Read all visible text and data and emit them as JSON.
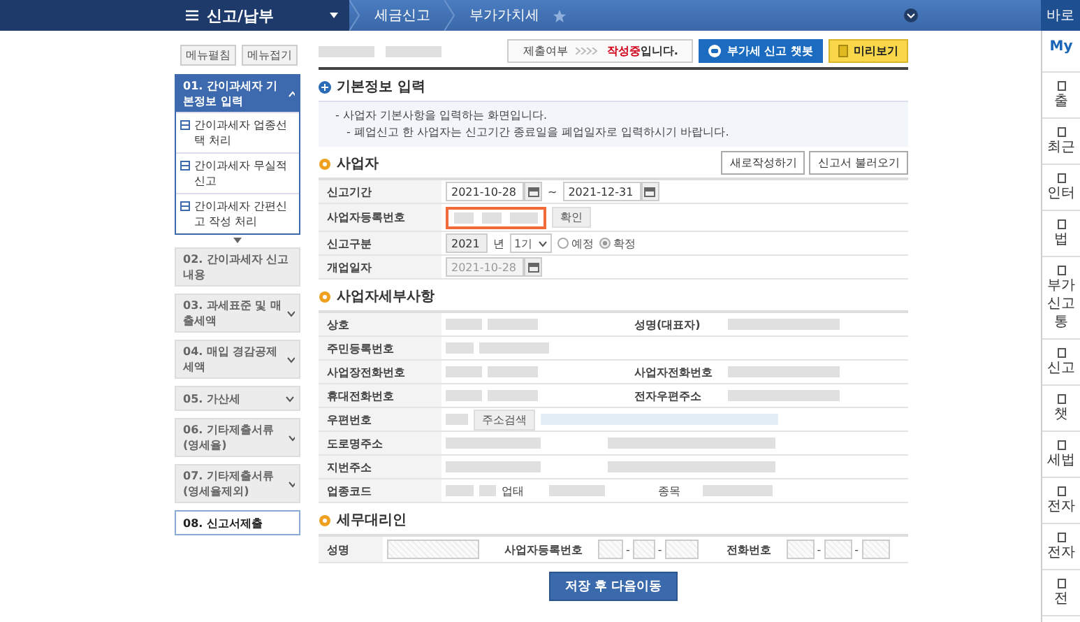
{
  "nav": {
    "title": "신고/납부",
    "breadcrumbs": [
      "세금신고",
      "부가가치세"
    ]
  },
  "quick_menu": {
    "title": "바로",
    "items": [
      {
        "lines": [
          "My"
        ],
        "kind": "link"
      },
      {
        "lines": [
          "출"
        ],
        "kind": "item"
      },
      {
        "lines": [
          "최근"
        ],
        "kind": "item"
      },
      {
        "lines": [
          "인터"
        ],
        "kind": "item"
      },
      {
        "lines": [
          "법"
        ],
        "kind": "item"
      },
      {
        "lines": [
          "부가",
          "신고",
          "통"
        ],
        "kind": "item"
      },
      {
        "lines": [
          "신고"
        ],
        "kind": "item"
      },
      {
        "lines": [
          "챗"
        ],
        "kind": "item"
      },
      {
        "lines": [
          "세법"
        ],
        "kind": "item"
      },
      {
        "lines": [
          "전자"
        ],
        "kind": "item"
      },
      {
        "lines": [
          "전자"
        ],
        "kind": "item"
      },
      {
        "lines": [
          "전"
        ],
        "kind": "item"
      }
    ]
  },
  "left_menu": {
    "buttons": [
      "메뉴펼침",
      "메뉴접기"
    ],
    "steps": [
      {
        "label": "01. 간이과세자 기본정보 입력",
        "selected": true,
        "expanded": true,
        "disabled": false,
        "children": [
          {
            "label": "간이과세자 업종선택 처리"
          },
          {
            "label": "간이과세자 무실적신고"
          },
          {
            "label": "간이과세자 간편신고 작성 처리"
          }
        ]
      },
      {
        "label": "02. 간이과세자 신고내용",
        "selected": false,
        "expanded": false,
        "disabled": true,
        "expandable": false
      },
      {
        "label": "03. 과세표준 및 매출세액",
        "selected": false,
        "expanded": false,
        "disabled": true,
        "expandable": true
      },
      {
        "label": "04. 매입 경감공제세액",
        "selected": false,
        "expanded": false,
        "disabled": true,
        "expandable": true
      },
      {
        "label": "05. 가산세",
        "selected": false,
        "expanded": false,
        "disabled": true,
        "expandable": true
      },
      {
        "label": "06. 기타제출서류(영세율)",
        "selected": false,
        "expanded": false,
        "disabled": true,
        "expandable": true
      },
      {
        "label": "07. 기타제출서류(영세율제외)",
        "selected": false,
        "expanded": false,
        "disabled": true,
        "expandable": true
      },
      {
        "label": "08. 신고서제출",
        "selected": false,
        "expanded": false,
        "disabled": false,
        "expandable": false
      }
    ]
  },
  "header": {
    "submission_label": "제출여부",
    "status": "작성중",
    "status_suffix": "입니다.",
    "buttons": [
      {
        "label": "부가세 신고 챗봇",
        "kind": "chatbot"
      },
      {
        "label": "미리보기",
        "kind": "preview"
      }
    ]
  },
  "basic_info": {
    "title": "기본정보 입력",
    "notices": [
      "- 사업자 기본사항을 입력하는 화면입니다.",
      "- 폐업신고 한 사업자는 신고기간 종료일을 폐업일자로 입력하시기 바랍니다."
    ]
  },
  "business": {
    "title": "사업자",
    "buttons": [
      "새로작성하기",
      "신고서 불러오기"
    ],
    "period": {
      "label": "신고기간",
      "from": "2021-10-28",
      "separator": "~",
      "to": "2021-12-31"
    },
    "registration": {
      "label": "사업자등록번호",
      "button": "확인",
      "highlighted": true
    },
    "report_type": {
      "label": "신고구분",
      "year": "2021",
      "year_unit": "년",
      "term": "1기",
      "options": [
        {
          "label": "예정",
          "selected": false
        },
        {
          "label": "확정",
          "selected": true
        }
      ]
    },
    "opening_date": {
      "label": "개업일자",
      "value": "2021-10-28",
      "disabled": true
    }
  },
  "details": {
    "title": "사업자세부사항",
    "rows": [
      {
        "kind": "pair",
        "label": "상호",
        "label_2": "성명(대표자)"
      },
      {
        "kind": "single",
        "label": "주민등록번호"
      },
      {
        "kind": "pair",
        "label": "사업장전화번호",
        "label_2": "사업자전화번호"
      },
      {
        "kind": "pair",
        "label": "휴대전화번호",
        "label_2": "전자우편주소"
      },
      {
        "kind": "zip",
        "label": "우편번호",
        "button": "주소검색"
      },
      {
        "kind": "wide",
        "label": "도로명주소"
      },
      {
        "kind": "wide",
        "label": "지번주소"
      },
      {
        "kind": "industry",
        "label": "업종코드",
        "label_2": "업태",
        "label_3": "종목"
      }
    ]
  },
  "tax_agent": {
    "title": "세무대리인",
    "name_label": "성명",
    "reg_label": "사업자등록번호",
    "phone_label": "전화번호",
    "separator": "-"
  },
  "submit_button": "저장 후 다음이동"
}
